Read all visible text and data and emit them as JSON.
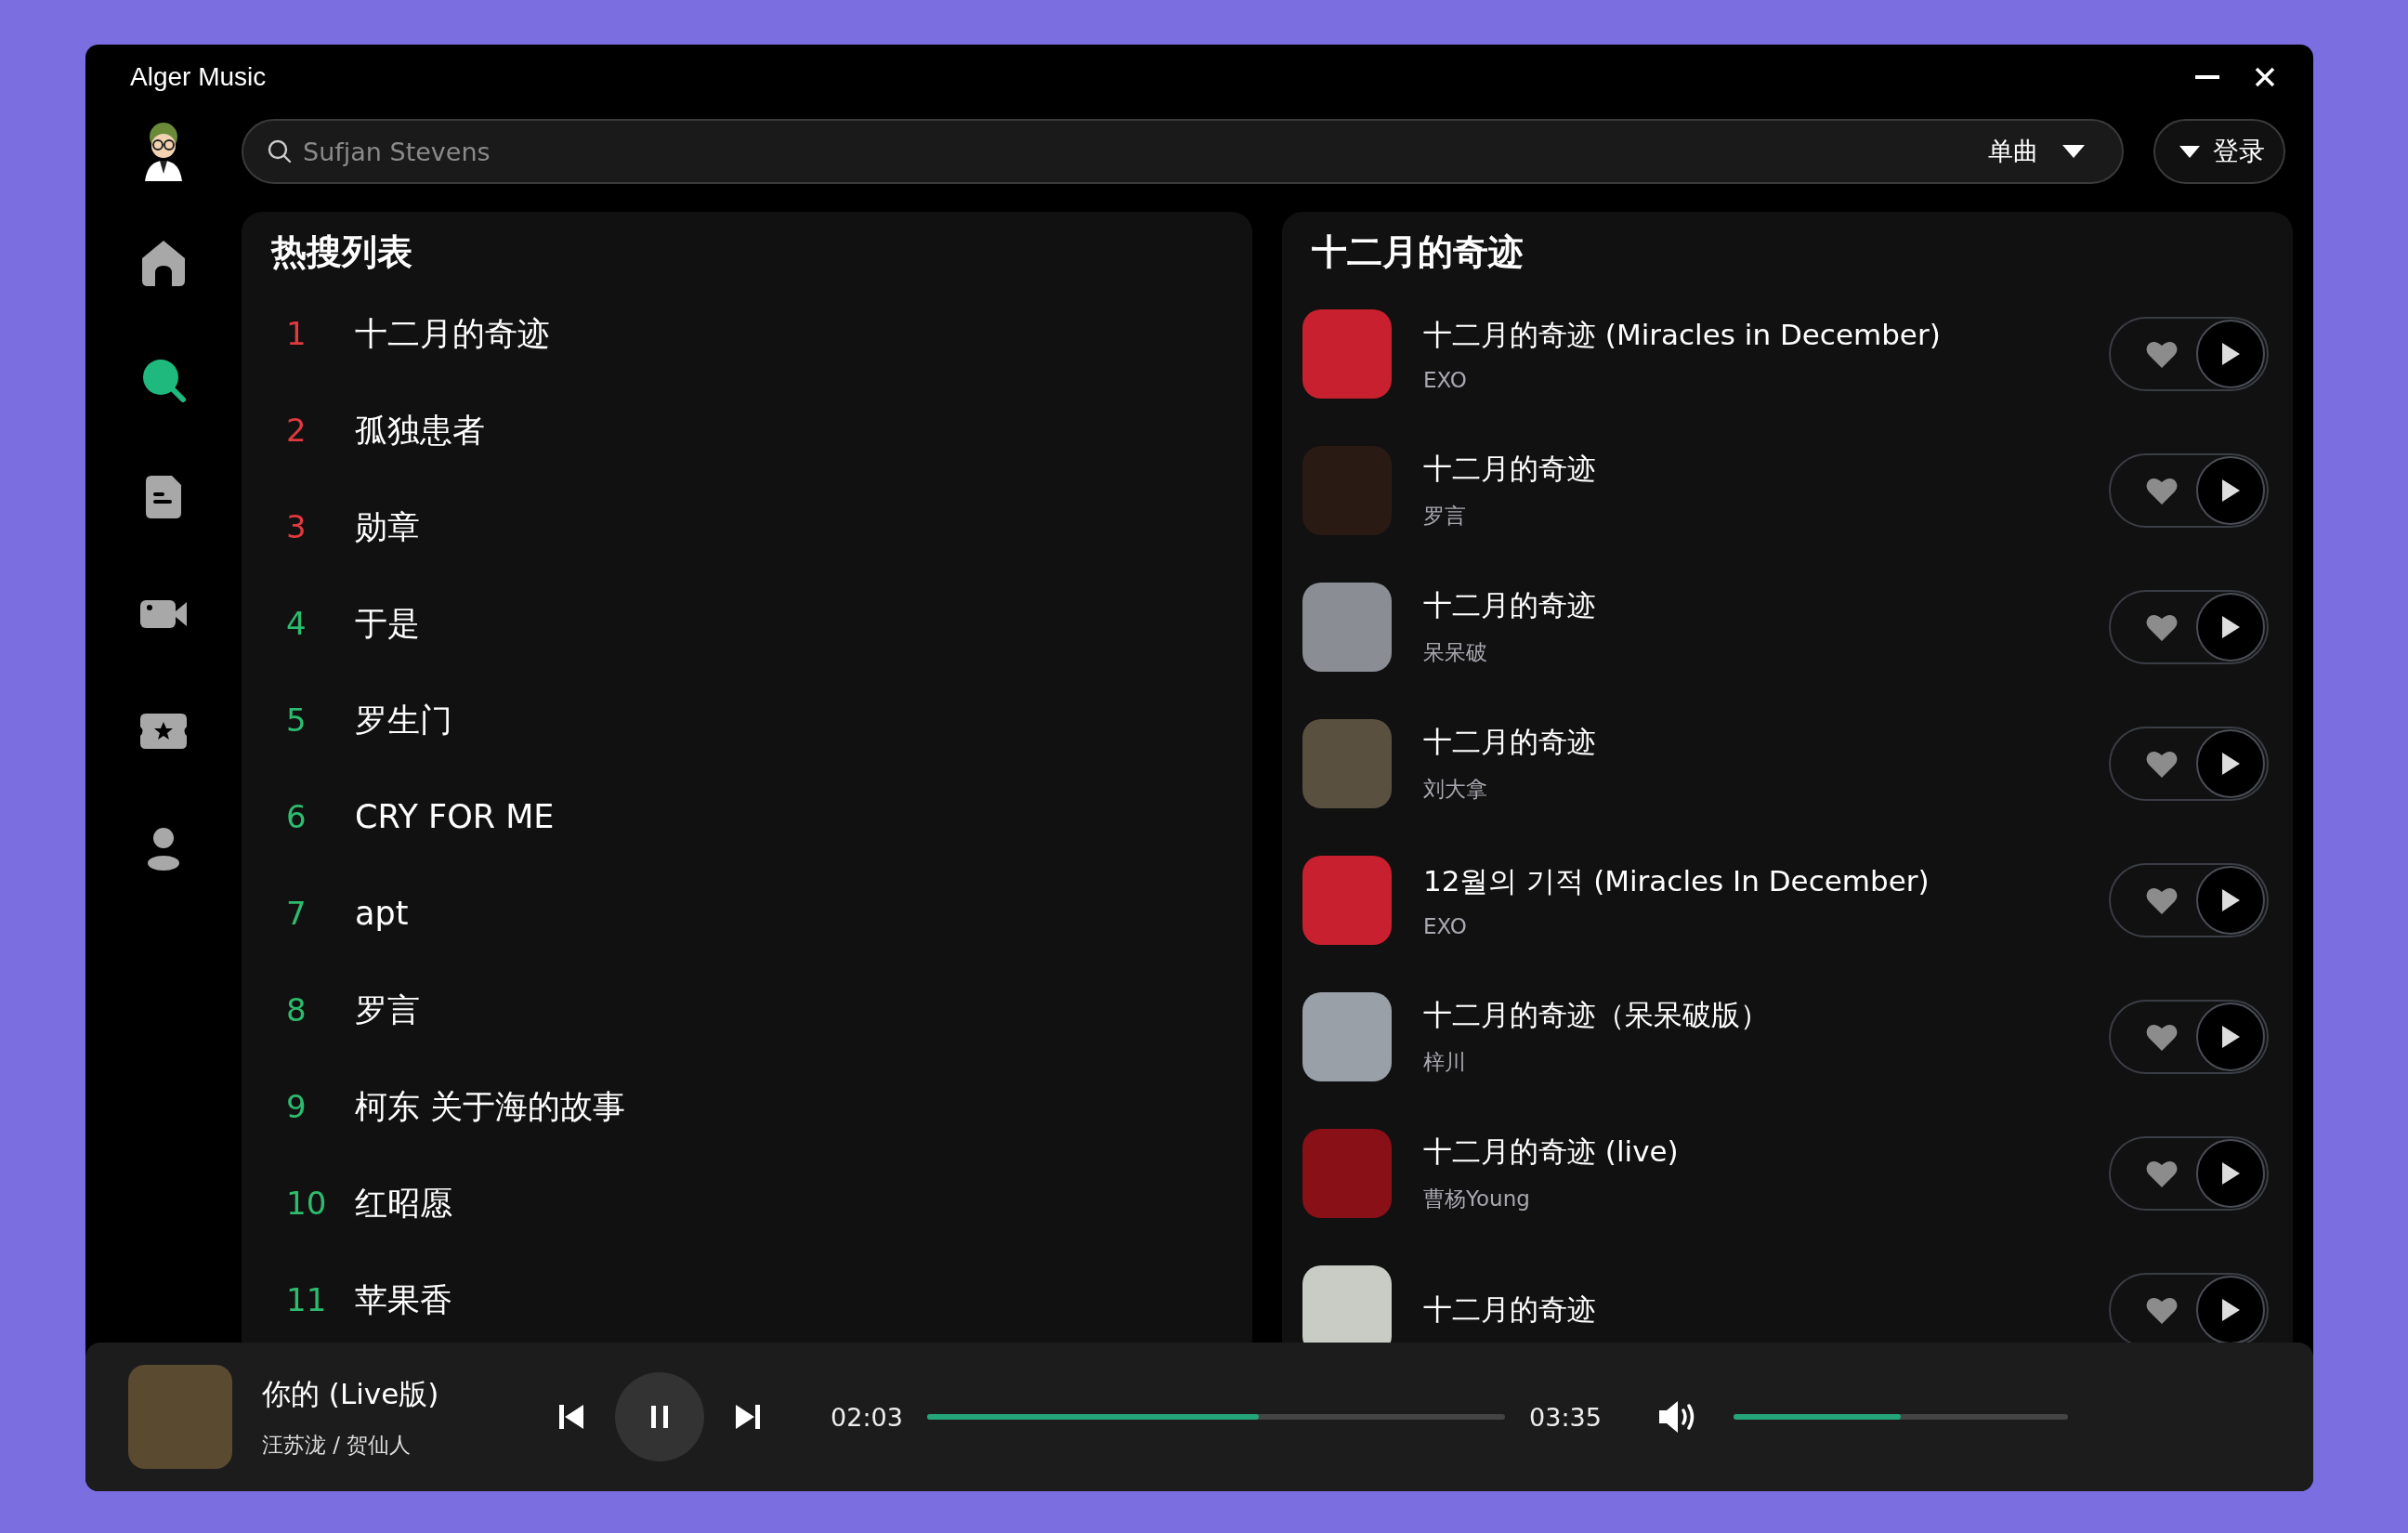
{
  "window": {
    "title": "Alger Music"
  },
  "search": {
    "placeholder": "Sufjan Stevens",
    "type_label": "单曲"
  },
  "login_button": "登录",
  "sidebar": {
    "items": [
      {
        "kind": "home",
        "selected": false
      },
      {
        "kind": "search",
        "selected": true
      },
      {
        "kind": "list",
        "selected": false
      },
      {
        "kind": "video",
        "selected": false
      },
      {
        "kind": "ticket",
        "selected": false
      },
      {
        "kind": "user",
        "selected": false
      }
    ]
  },
  "hot_list": {
    "title": "热搜列表",
    "items": [
      {
        "rank": "1",
        "label": "十二月的奇迹",
        "color": "#e0393e"
      },
      {
        "rank": "2",
        "label": "孤独患者",
        "color": "#e0393e"
      },
      {
        "rank": "3",
        "label": "勋章",
        "color": "#e0393e"
      },
      {
        "rank": "4",
        "label": "于是",
        "color": "#2dbb6d"
      },
      {
        "rank": "5",
        "label": "罗生门",
        "color": "#2dbb6d"
      },
      {
        "rank": "6",
        "label": "CRY FOR ME",
        "color": "#2dbb6d"
      },
      {
        "rank": "7",
        "label": "apt",
        "color": "#2dbb6d"
      },
      {
        "rank": "8",
        "label": "罗言",
        "color": "#2dbb6d"
      },
      {
        "rank": "9",
        "label": "柯东 关于海的故事",
        "color": "#2dbb6d"
      },
      {
        "rank": "10",
        "label": "红昭愿",
        "color": "#2dbb6d"
      },
      {
        "rank": "11",
        "label": "苹果香",
        "color": "#2dbb6d"
      }
    ]
  },
  "results": {
    "title": "十二月的奇迹",
    "songs": [
      {
        "title": "十二月的奇迹 (Miracles in December)",
        "artist": "EXO",
        "color": "#c8202e"
      },
      {
        "title": "十二月的奇迹",
        "artist": "罗言",
        "color": "#2a1a14"
      },
      {
        "title": "十二月的奇迹",
        "artist": "呆呆破",
        "color": "#8a8e94"
      },
      {
        "title": "十二月的奇迹",
        "artist": "刘大拿",
        "color": "#5a5040"
      },
      {
        "title": "12월의 기적 (Miracles In December)",
        "artist": "EXO",
        "color": "#c8202e"
      },
      {
        "title": "十二月的奇迹（呆呆破版）",
        "artist": "梓川",
        "color": "#9aa0a8"
      },
      {
        "title": "十二月的奇迹 (live)",
        "artist": "曹杨Young",
        "color": "#8a1018"
      },
      {
        "title": "十二月的奇迹",
        "color": "#c8ccc4"
      }
    ]
  },
  "player": {
    "title": "你的 (Live版)",
    "artist": "汪苏泷 / 贺仙人",
    "playing": true,
    "elapsed": "02:03",
    "duration": "03:35",
    "progress": {
      "level": 0.574
    },
    "volume": {
      "level": 0.5
    }
  }
}
